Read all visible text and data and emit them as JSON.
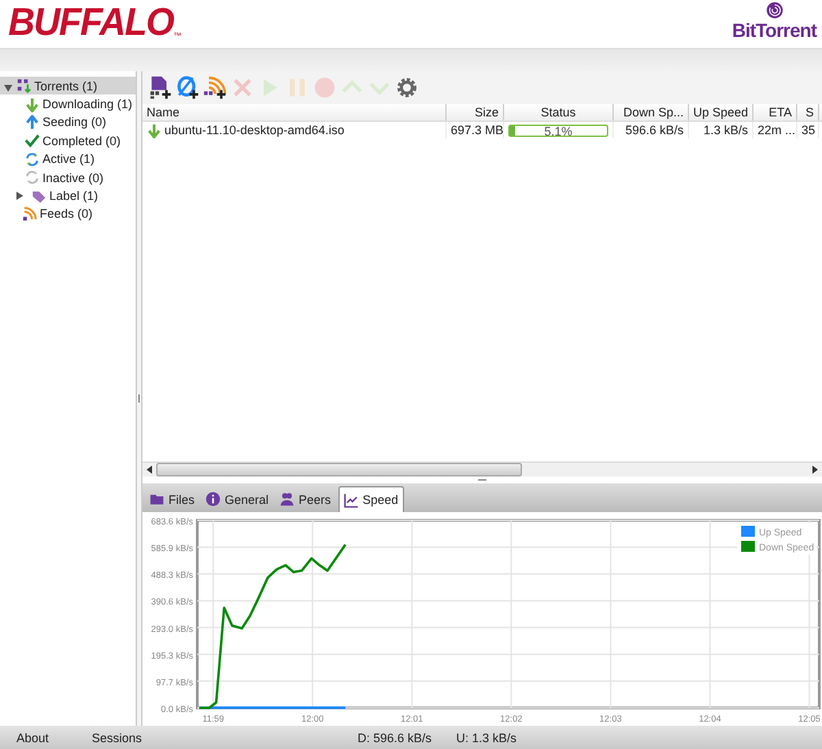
{
  "header": {
    "brand": "BUFFALO",
    "trademark": "™",
    "product": "BitTorrent"
  },
  "sidebar": {
    "items": [
      {
        "label": "Torrents (1)",
        "kind": "torrents",
        "selected": true,
        "expanded": true,
        "children": [
          {
            "label": "Downloading (1)",
            "kind": "down",
            "selected": false
          },
          {
            "label": "Seeding (0)",
            "kind": "up",
            "selected": false
          },
          {
            "label": "Completed (0)",
            "kind": "check",
            "selected": false
          },
          {
            "label": "Active (1)",
            "kind": "active",
            "selected": false
          },
          {
            "label": "Inactive (0)",
            "kind": "inactive",
            "selected": false
          }
        ]
      },
      {
        "label": "Label (1)",
        "kind": "label",
        "selected": false,
        "expanded": false
      },
      {
        "label": "Feeds (0)",
        "kind": "feed",
        "selected": false
      }
    ]
  },
  "toolbar": [
    {
      "kind": "add-file",
      "disabled": false
    },
    {
      "kind": "add-url",
      "disabled": false
    },
    {
      "kind": "add-feed",
      "disabled": false
    },
    {
      "kind": "remove",
      "disabled": true
    },
    {
      "kind": "start",
      "disabled": true
    },
    {
      "kind": "pause",
      "disabled": true
    },
    {
      "kind": "stop",
      "disabled": true
    },
    {
      "kind": "up",
      "disabled": true
    },
    {
      "kind": "down",
      "disabled": true
    },
    {
      "kind": "settings",
      "disabled": false
    }
  ],
  "table": {
    "columns": [
      "Name",
      "Size",
      "Status",
      "Down Sp...",
      "Up Speed",
      "ETA",
      "S"
    ],
    "rows": [
      {
        "name": "ubuntu-11.10-desktop-amd64.iso",
        "size": "697.3 MB",
        "status": "5.1%",
        "level": 0.051,
        "down_speed": "596.6 kB/s",
        "up_speed": "1.3 kB/s",
        "eta": "22m ...",
        "column_7": "35",
        "selected": false
      }
    ]
  },
  "tabs": [
    {
      "label": "Files",
      "kind": "folder",
      "selected": false
    },
    {
      "label": "General",
      "kind": "info",
      "selected": false
    },
    {
      "label": "Peers",
      "kind": "peers",
      "selected": false
    },
    {
      "label": "Speed",
      "kind": "chart",
      "selected": true
    }
  ],
  "speed": {
    "chart_data": {
      "type": "line",
      "x": [
        718.86,
        718.96,
        719.03,
        719.11,
        719.19,
        719.29,
        719.37,
        719.45,
        719.55,
        719.64,
        719.73,
        719.81,
        719.89,
        719.99,
        720.07,
        720.15,
        720.33
      ],
      "series": [
        {
          "name": "Up Speed",
          "color": "#1e88ff",
          "values": [
            1,
            1,
            1,
            1,
            1,
            1,
            1,
            1,
            1,
            1,
            1,
            1,
            1,
            1,
            1,
            1,
            1
          ]
        },
        {
          "name": "Down Speed",
          "color": "#0a8a0a",
          "values": [
            0,
            0,
            20,
            365,
            300,
            290,
            335,
            395,
            475,
            505,
            520,
            495,
            500,
            545,
            520,
            500,
            595
          ]
        }
      ],
      "grid": true,
      "legend": true,
      "xlim": [
        718.84,
        725.1
      ],
      "ylim": [
        0,
        683.6
      ],
      "xticks": [
        {
          "value": 719,
          "label": "11:59"
        },
        {
          "value": 720,
          "label": "12:00"
        },
        {
          "value": 721,
          "label": "12:01"
        },
        {
          "value": 722,
          "label": "12:02"
        },
        {
          "value": 723,
          "label": "12:03"
        },
        {
          "value": 724,
          "label": "12:04"
        },
        {
          "value": 725,
          "label": "12:05"
        }
      ],
      "yticks": [
        {
          "value": 0,
          "label": "0.0 kB/s"
        },
        {
          "value": 97.7,
          "label": "97.7 kB/s"
        },
        {
          "value": 195.3,
          "label": "195.3 kB/s"
        },
        {
          "value": 293,
          "label": "293.0 kB/s"
        },
        {
          "value": 390.6,
          "label": "390.6 kB/s"
        },
        {
          "value": 488.3,
          "label": "488.3 kB/s"
        },
        {
          "value": 585.9,
          "label": "585.9 kB/s"
        },
        {
          "value": 683.6,
          "label": "683.6 kB/s"
        }
      ]
    }
  },
  "status_bar": {
    "about": "About",
    "sessions": "Sessions",
    "download": "D: 596.6 kB/s",
    "upload": "U: 1.3 kB/s"
  }
}
